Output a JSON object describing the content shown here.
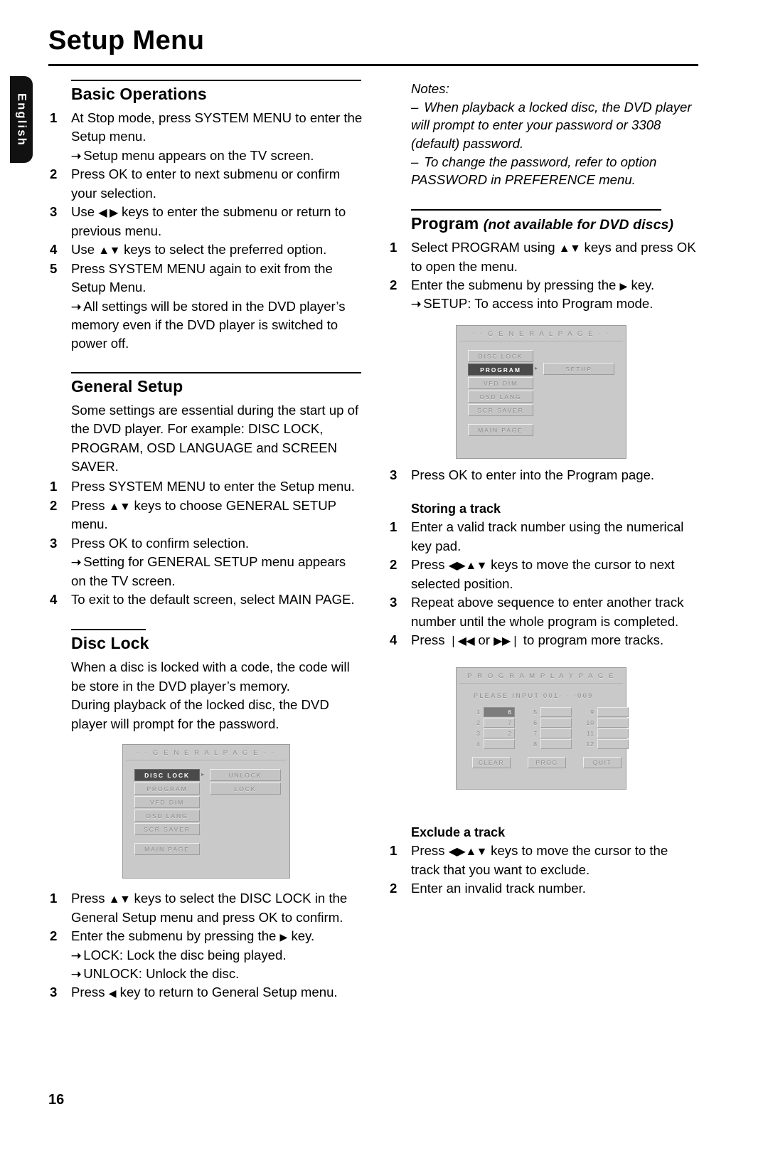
{
  "document": {
    "title": "Setup Menu",
    "page_number": "16",
    "language_tab": "English"
  },
  "left_column": {
    "basic_operations": {
      "heading": "Basic Operations",
      "steps": [
        {
          "num": "1",
          "text": "At Stop mode, press SYSTEM MENU to enter the Setup menu.",
          "arrows": [
            "Setup menu appears on the TV screen."
          ]
        },
        {
          "num": "2",
          "text": "Press OK to enter to next submenu or confirm your selection.",
          "arrows": []
        },
        {
          "num": "3",
          "text_pre": "Use ",
          "keys": "◀ ▶",
          "text_post": " keys to enter the submenu or return to previous menu.",
          "arrows": []
        },
        {
          "num": "4",
          "text_pre": "Use ",
          "keys": "▲▼",
          "text_post": " keys to select the preferred option.",
          "arrows": []
        },
        {
          "num": "5",
          "text": "Press SYSTEM MENU again to exit from the Setup Menu.",
          "arrows": [
            "All settings will be stored in the DVD player’s memory even if the DVD player is switched to power off."
          ]
        }
      ]
    },
    "general_setup": {
      "heading": "General Setup",
      "intro": "Some settings are essential during the start up of the DVD player. For example: DISC LOCK, PROGRAM, OSD LANGUAGE and SCREEN SAVER.",
      "steps": [
        {
          "num": "1",
          "text": "Press SYSTEM MENU to enter the Setup menu.",
          "arrows": []
        },
        {
          "num": "2",
          "text_pre": "Press ",
          "keys": "▲▼",
          "text_post": " keys to choose GENERAL SETUP menu.",
          "arrows": []
        },
        {
          "num": "3",
          "text": "Press OK to confirm selection.",
          "arrows": [
            "Setting for GENERAL SETUP menu appears on the TV screen."
          ]
        },
        {
          "num": "4",
          "text": "To exit to the default screen, select MAIN PAGE.",
          "arrows": []
        }
      ]
    },
    "disc_lock": {
      "heading": "Disc Lock",
      "intro_line1": "When a disc is locked with a code, the code will be store in the DVD player’s memory.",
      "intro_line2": "During playback of the locked disc, the DVD player will prompt for the password.",
      "steps": [
        {
          "num": "1",
          "text_pre": "Press ",
          "keys": "▲▼",
          "text_post": " keys to select the DISC LOCK in the General Setup menu and press OK to confirm.",
          "arrows": []
        },
        {
          "num": "2",
          "text_pre": "Enter the submenu by pressing the ",
          "keys": "▶",
          "text_post": " key.",
          "arrows": [
            "LOCK: Lock the disc being played.",
            "UNLOCK: Unlock the disc."
          ]
        },
        {
          "num": "3",
          "text_pre": "Press ",
          "keys": "◀",
          "text_post": " key to return to General Setup menu.",
          "arrows": []
        }
      ]
    }
  },
  "right_column": {
    "notes": {
      "label": "Notes:",
      "items": [
        "When playback a locked disc, the DVD player will prompt to enter your password or 3308 (default) password.",
        "To change the password, refer to option PASSWORD in PREFERENCE menu."
      ]
    },
    "program": {
      "heading": "Program",
      "heading_sub": "(not available for DVD discs)",
      "steps": [
        {
          "num": "1",
          "text_pre": "Select PROGRAM using ",
          "keys": "▲▼",
          "text_post": " keys and press OK to open the menu.",
          "arrows": []
        },
        {
          "num": "2",
          "text_pre": "Enter the submenu by pressing the ",
          "keys": "▶",
          "text_post": " key.",
          "arrows": [
            "SETUP: To access into Program mode."
          ]
        },
        {
          "num": "3",
          "text": "Press OK to enter into the Program page.",
          "arrows": []
        }
      ]
    },
    "storing_a_track": {
      "heading": "Storing a track",
      "steps": [
        {
          "num": "1",
          "text": "Enter a valid track number using the numerical key pad.",
          "arrows": []
        },
        {
          "num": "2",
          "text_pre": "Press ",
          "keys": "◀▶▲▼",
          "text_post": " keys to move the cursor to next selected position.",
          "arrows": []
        },
        {
          "num": "3",
          "text": "Repeat above sequence to enter another track number until the whole program is completed.",
          "arrows": []
        },
        {
          "num": "4",
          "text_pre": "Press ",
          "keys": "❘◀◀",
          "text_mid": " or ",
          "keys2": "▶▶❘",
          "text_post": " to program more tracks.",
          "arrows": []
        }
      ]
    },
    "exclude_a_track": {
      "heading": "Exclude a track",
      "steps": [
        {
          "num": "1",
          "text_pre": "Press ",
          "keys": "◀▶▲▼",
          "text_post": " keys to move the cursor to the track that you want to exclude.",
          "arrows": []
        },
        {
          "num": "2",
          "text": "Enter an invalid track number.",
          "arrows": []
        }
      ]
    }
  },
  "osd_screens": {
    "general_page_disc_lock": {
      "title": "- -  G E N E R A L   P A G E  - -",
      "menu_items": [
        "DISC LOCK",
        "PROGRAM",
        "VFD DIM",
        "OSD LANG",
        "SCR SAVER"
      ],
      "selected_item": "DISC LOCK",
      "main_page_label": "MAIN PAGE",
      "submenu_items": [
        "UNLOCK",
        "LOCK"
      ]
    },
    "general_page_program": {
      "title": "- -  G E N E R A L   P A G E  - -",
      "menu_items": [
        "DISC LOCK",
        "PROGRAM",
        "VFD DIM",
        "OSD LANG",
        "SCR SAVER"
      ],
      "selected_item": "PROGRAM",
      "main_page_label": "MAIN PAGE",
      "submenu_items": [
        "SETUP"
      ]
    },
    "program_play_page": {
      "title": "P R O G R A M   P L A Y   P A G E",
      "input_prompt": "PLEASE INPUT 001- - -009",
      "groups": [
        {
          "rows": [
            {
              "idx": "1",
              "value": "6",
              "selected": true
            },
            {
              "idx": "2",
              "value": "7",
              "selected": false
            },
            {
              "idx": "3",
              "value": "2",
              "selected": false
            },
            {
              "idx": "4",
              "value": "",
              "selected": false
            }
          ]
        },
        {
          "rows": [
            {
              "idx": "5",
              "value": "",
              "selected": false
            },
            {
              "idx": "6",
              "value": "",
              "selected": false
            },
            {
              "idx": "7",
              "value": "",
              "selected": false
            },
            {
              "idx": "8",
              "value": "",
              "selected": false
            }
          ]
        },
        {
          "rows": [
            {
              "idx": "9",
              "value": "",
              "selected": false
            },
            {
              "idx": "10",
              "value": "",
              "selected": false
            },
            {
              "idx": "11",
              "value": "",
              "selected": false
            },
            {
              "idx": "12",
              "value": "",
              "selected": false
            }
          ]
        }
      ],
      "buttons": [
        "CLEAR",
        "PROG",
        "QUIT"
      ]
    }
  }
}
